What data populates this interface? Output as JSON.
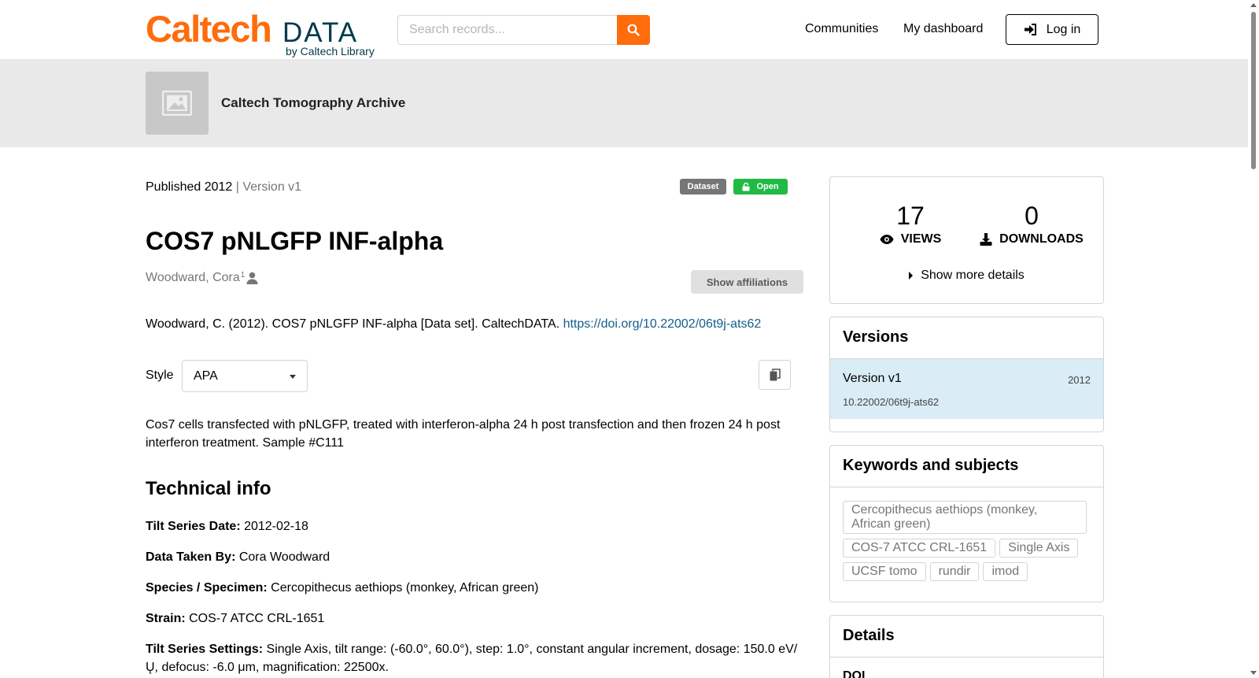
{
  "header": {
    "logo_caltech": "Caltech",
    "logo_data": "DATA",
    "logo_by": "by Caltech Library",
    "search_placeholder": "Search records...",
    "nav": [
      "Communities",
      "My dashboard"
    ],
    "login_label": "Log in"
  },
  "community": {
    "name": "Caltech Tomography Archive"
  },
  "record": {
    "published": "Published 2012",
    "version_sep": " | Version v1",
    "resource_type": "Dataset",
    "access": "Open",
    "title": "COS7 pNLGFP INF-alpha",
    "creator": "Woodward, Cora",
    "creator_sup": "1",
    "show_affiliations": "Show affiliations",
    "citation_text": "Woodward, C. (2012). COS7 pNLGFP INF-alpha [Data set]. CaltechDATA. ",
    "citation_link": "https://doi.org/10.22002/06t9j-ats62",
    "style_label": "Style",
    "style_value": "APA",
    "description": "Cos7 cells transfected with pNLGFP, treated with interferon-alpha 24 h post transfection and then frozen 24 h post interferon treatment. Sample #C111",
    "technical_heading": "Technical info",
    "fields": [
      {
        "label": "Tilt Series Date:",
        "value": " 2012-02-18"
      },
      {
        "label": "Data Taken By:",
        "value": " Cora Woodward"
      },
      {
        "label": "Species / Specimen:",
        "value": " Cercopithecus aethiops (monkey, African green)"
      },
      {
        "label": "Strain:",
        "value": " COS-7 ATCC CRL-1651"
      },
      {
        "label": "Tilt Series Settings:",
        "value": " Single Axis, tilt range: (-60.0°, 60.0°), step: 1.0°, constant angular increment, dosage: 150.0 eV/Ų, defocus: -6.0 μm, magnification: 22500x."
      }
    ]
  },
  "stats": {
    "views": "17",
    "views_label": "VIEWS",
    "downloads": "0",
    "downloads_label": "DOWNLOADS",
    "more": "Show more details"
  },
  "versions": {
    "heading": "Versions",
    "item_label": "Version v1",
    "item_year": "2012",
    "item_doi": "10.22002/06t9j-ats62"
  },
  "keywords": {
    "heading": "Keywords and subjects",
    "items": [
      "Cercopithecus aethiops (monkey, African green)",
      "COS-7 ATCC CRL-1651",
      "Single Axis",
      "UCSF tomo",
      "rundir",
      "imod"
    ]
  },
  "details": {
    "heading": "Details",
    "doi_label": "DOI"
  },
  "colors": {
    "brand_orange": "#FF6C0C",
    "brand_navy": "#003B4C",
    "link": "#125E8A",
    "open_green": "#21BA45",
    "version_bg": "#DAECF5"
  },
  "icons": [
    "search-icon",
    "sign-in-icon",
    "image-placeholder-icon",
    "lock-open-icon",
    "user-icon",
    "copy-icon",
    "eye-icon",
    "download-icon",
    "caret-right-icon"
  ]
}
